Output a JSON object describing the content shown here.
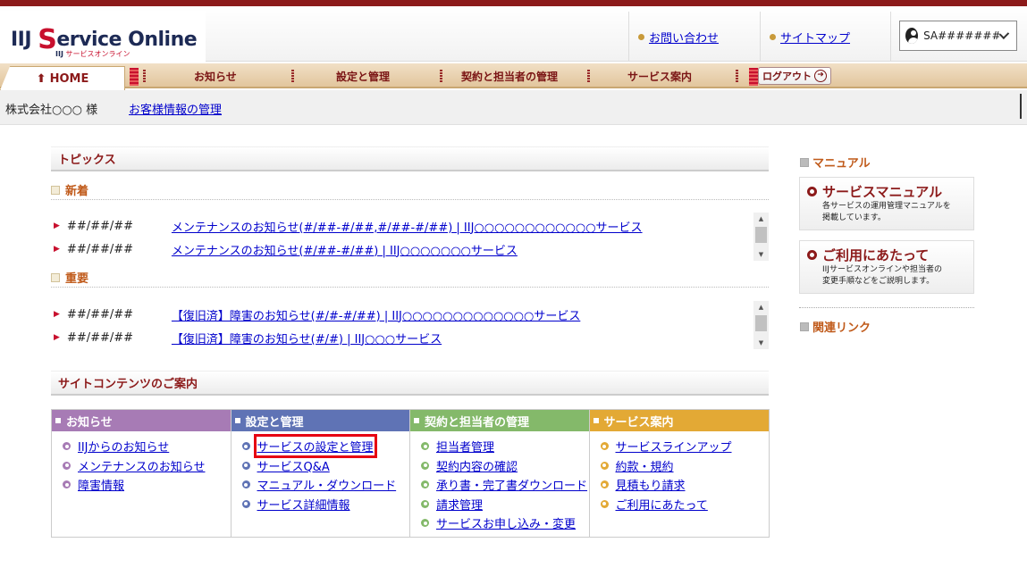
{
  "header": {
    "logo_iij": "IIJ",
    "logo_s": "S",
    "logo_rest": "ervice Online",
    "logo_sub_iij": "IIJ",
    "logo_sub": "サービスオンライン",
    "contact_link": "お問い合わせ",
    "sitemap_link": "サイトマップ",
    "user_label": "SA#######"
  },
  "nav": {
    "home": "HOME",
    "items": [
      "お知らせ",
      "設定と管理",
      "契約と担当者の管理",
      "サービス案内"
    ],
    "logout": "ログアウト"
  },
  "infobar": {
    "company": "株式会社○○○ 様",
    "customer_link": "お客様情報の管理"
  },
  "topics": {
    "title": "トピックス",
    "new_title": "新着",
    "new_items": [
      {
        "date": "##/##/##",
        "text": "メンテナンスのお知らせ(#/##-#/##,#/##-#/##) | IIJ○○○○○○○○○○○○サービス"
      },
      {
        "date": "##/##/##",
        "text": "メンテナンスのお知らせ(#/##-#/##) | IIJ○○○○○○○サービス"
      }
    ],
    "important_title": "重要",
    "important_items": [
      {
        "date": "##/##/##",
        "text": "【復旧済】障害のお知らせ(#/#-#/##) | IIJ○○○○○○○○○○○○○サービス"
      },
      {
        "date": "##/##/##",
        "text": "【復旧済】障害のお知らせ(#/#) | IIJ○○○サービス"
      }
    ]
  },
  "site_contents": {
    "title": "サイトコンテンツのご案内",
    "columns": [
      {
        "title": "お知らせ",
        "color": "#a77bb5",
        "dot": "#a77bb5",
        "items": [
          "IIJからのお知らせ",
          "メンテナンスのお知らせ",
          "障害情報"
        ]
      },
      {
        "title": "設定と管理",
        "color": "#5f73b5",
        "dot": "#5f73b5",
        "items": [
          "サービスの設定と管理",
          "サービスQ&A",
          "マニュアル・ダウンロード",
          "サービス詳細情報"
        ]
      },
      {
        "title": "契約と担当者の管理",
        "color": "#84b96a",
        "dot": "#84b96a",
        "items": [
          "担当者管理",
          "契約内容の確認",
          "承り書・完了書ダウンロード",
          "請求管理",
          "サービスお申し込み・変更"
        ]
      },
      {
        "title": "サービス案内",
        "color": "#e3a935",
        "dot": "#e3a935",
        "items": [
          "サービスラインアップ",
          "約款・規約",
          "見積もり請求",
          "ご利用にあたって"
        ]
      }
    ]
  },
  "sidebar": {
    "manual_title": "マニュアル",
    "service_manual_title": "サービスマニュアル",
    "service_manual_desc1": "各サービスの運用管理マニュアルを",
    "service_manual_desc2": "掲載しています。",
    "usage_title": "ご利用にあたって",
    "usage_desc1": "IIJサービスオンラインや担当者の",
    "usage_desc2": "変更手順などをご説明します。",
    "related_title": "関連リンク"
  },
  "colors": {
    "brand_red": "#8c1a1a",
    "highlight": "#e60012"
  }
}
